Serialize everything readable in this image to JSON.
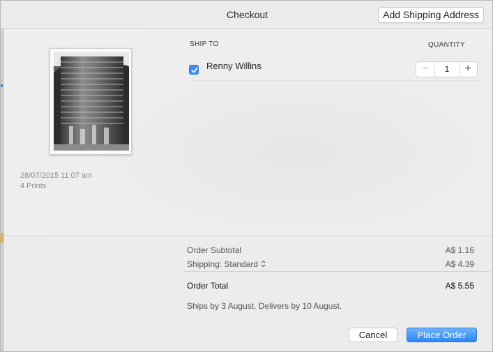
{
  "window": {
    "title": "Checkout"
  },
  "header": {
    "add_shipping_label": "Add Shipping Address"
  },
  "print": {
    "date": "28/07/2015 11:07 am",
    "count": "4 Prints"
  },
  "ship_to": {
    "heading": "SHIP TO",
    "recipient": "Renny Willins",
    "selected": true
  },
  "quantity": {
    "heading": "QUANTITY",
    "value": "1",
    "minus": "−",
    "plus": "+"
  },
  "summary": {
    "subtotal_label": "Order Subtotal",
    "subtotal_value": "A$ 1.16",
    "shipping_label": "Shipping: Standard",
    "shipping_value": "A$ 4.39",
    "total_label": "Order Total",
    "total_value": "A$ 5.55",
    "delivery_note": "Ships by 3 August. Delivers by 10 August."
  },
  "actions": {
    "cancel_label": "Cancel",
    "place_order_label": "Place Order"
  },
  "colors": {
    "accent": "#3d8ef0",
    "primary_button": "#2e86f4"
  }
}
